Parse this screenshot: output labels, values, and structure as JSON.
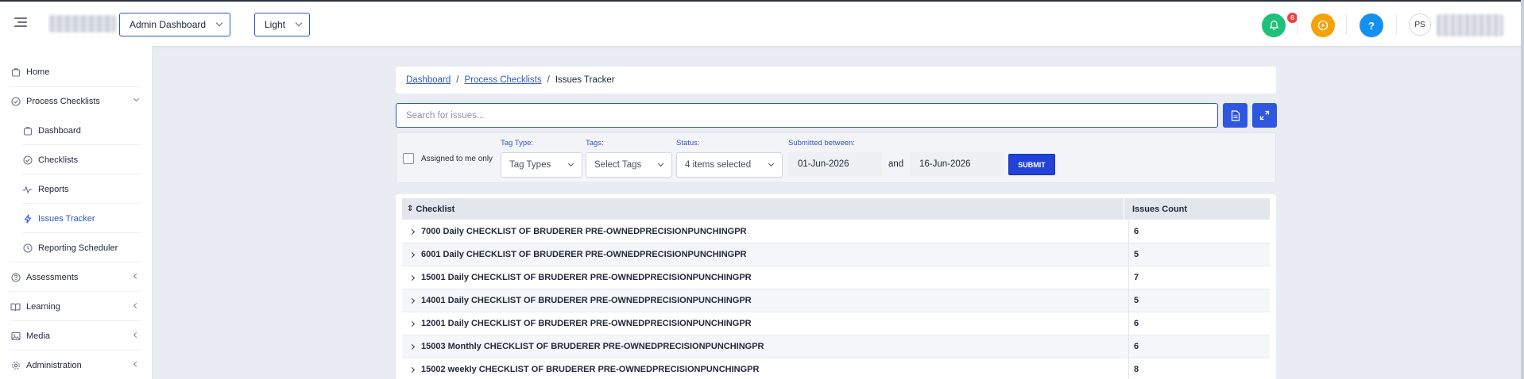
{
  "header": {
    "dashboard_select": "Admin Dashboard",
    "theme_select": "Light",
    "notification_count": "6",
    "help_label": "?",
    "avatar_initials": "PS"
  },
  "sidebar": {
    "items": [
      {
        "label": "Home",
        "icon": "home-icon"
      },
      {
        "label": "Process Checklists",
        "icon": "check-circle-icon"
      },
      {
        "label": "Dashboard",
        "icon": "briefcase-icon"
      },
      {
        "label": "Checklists",
        "icon": "check-circle-icon"
      },
      {
        "label": "Reports",
        "icon": "activity-icon"
      },
      {
        "label": "Issues Tracker",
        "icon": "lightning-icon"
      },
      {
        "label": "Reporting Scheduler",
        "icon": "clock-icon"
      },
      {
        "label": "Assessments",
        "icon": "question-circle-icon"
      },
      {
        "label": "Learning",
        "icon": "book-icon"
      },
      {
        "label": "Media",
        "icon": "image-icon"
      },
      {
        "label": "Administration",
        "icon": "gear-icon"
      }
    ]
  },
  "breadcrumb": {
    "dashboard": "Dashboard",
    "process_checklists": "Process Checklists",
    "separator": "/",
    "current": "Issues Tracker"
  },
  "search": {
    "placeholder": "Search for issues..."
  },
  "filters": {
    "assigned_label": "Assigned to me only",
    "tag_type_label": "Tag Type:",
    "tag_type_value": "Tag Types",
    "tags_label": "Tags:",
    "tags_value": "Select Tags",
    "status_label": "Status:",
    "status_value": "4 items selected",
    "submitted_label": "Submitted between:",
    "date_from": "01-Jun-2026",
    "and_label": "and",
    "date_to": "16-Jun-2026",
    "submit_label": "SUBMIT"
  },
  "table": {
    "headers": [
      "Checklist",
      "Issues Count"
    ],
    "sort_icon": "⇕",
    "rows": [
      {
        "checklist": "7000 Daily CHECKLIST OF BRUDERER PRE-OWNEDPRECISIONPUNCHINGPR",
        "count": "6"
      },
      {
        "checklist": "6001 Daily CHECKLIST OF BRUDERER PRE-OWNEDPRECISIONPUNCHINGPR",
        "count": "5"
      },
      {
        "checklist": "15001 Daily CHECKLIST OF BRUDERER PRE-OWNEDPRECISIONPUNCHINGPR",
        "count": "7"
      },
      {
        "checklist": "14001 Daily CHECKLIST OF BRUDERER PRE-OWNEDPRECISIONPUNCHINGPR",
        "count": "5"
      },
      {
        "checklist": "12001 Daily CHECKLIST OF BRUDERER PRE-OWNEDPRECISIONPUNCHINGPR",
        "count": "6"
      },
      {
        "checklist": "15003 Monthly CHECKLIST OF BRUDERER PRE-OWNEDPRECISIONPUNCHINGPR",
        "count": "6"
      },
      {
        "checklist": "15002 weekly CHECKLIST OF BRUDERER PRE-OWNEDPRECISIONPUNCHINGPR",
        "count": "8"
      }
    ]
  },
  "colors": {
    "accent": "#2f56c6",
    "notification": "#1ec07a",
    "play": "#f5a20a",
    "help": "#1490f0",
    "submit": "#2242d8"
  }
}
